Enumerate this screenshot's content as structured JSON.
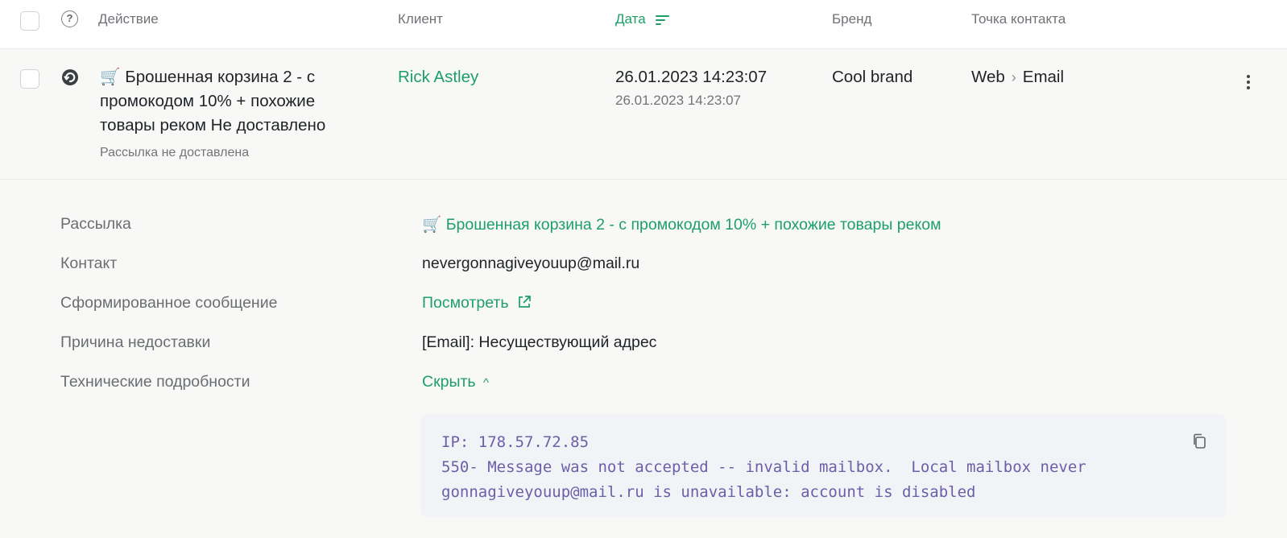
{
  "table": {
    "headers": {
      "action": "Действие",
      "client": "Клиент",
      "date": "Дата",
      "brand": "Бренд",
      "touchpoint": "Точка контакта"
    },
    "sorted_column": "date",
    "row": {
      "cart_emoji": "🛒",
      "action_title": "Брошенная корзина 2 - с промокодом 10% + похожие товары реком Не доставлено",
      "action_status": "Рассылка не доставлена",
      "client": "Rick Astley",
      "date_main": "26.01.2023 14:23:07",
      "date_sub": "26.01.2023 14:23:07",
      "brand": "Cool brand",
      "touchpoint_from": "Web",
      "touchpoint_sep": "›",
      "touchpoint_to": "Email"
    }
  },
  "details": {
    "mailing_label": "Рассылка",
    "mailing_value": "Брошенная корзина 2 - с промокодом 10% + похожие товары реком",
    "contact_label": "Контакт",
    "contact_value": "nevergonnagiveyouup@mail.ru",
    "message_label": "Сформированное сообщение",
    "message_link": "Посмотреть",
    "reason_label": "Причина недоставки",
    "reason_value": "[Email]: Несуществующий адрес",
    "tech_label": "Технические подробности",
    "tech_toggle": "Скрыть",
    "tech_toggle_chevron": "^",
    "code_lines": [
      "IP: 178.57.72.85",
      "550- Message was not accepted -- invalid mailbox.  Local mailbox never",
      "gonnagiveyouup@mail.ru is unavailable: account is disabled"
    ]
  },
  "colors": {
    "accent_green": "#1e9e6a",
    "code_text": "#6b5fa8",
    "row_bg": "#f8f8f7"
  }
}
